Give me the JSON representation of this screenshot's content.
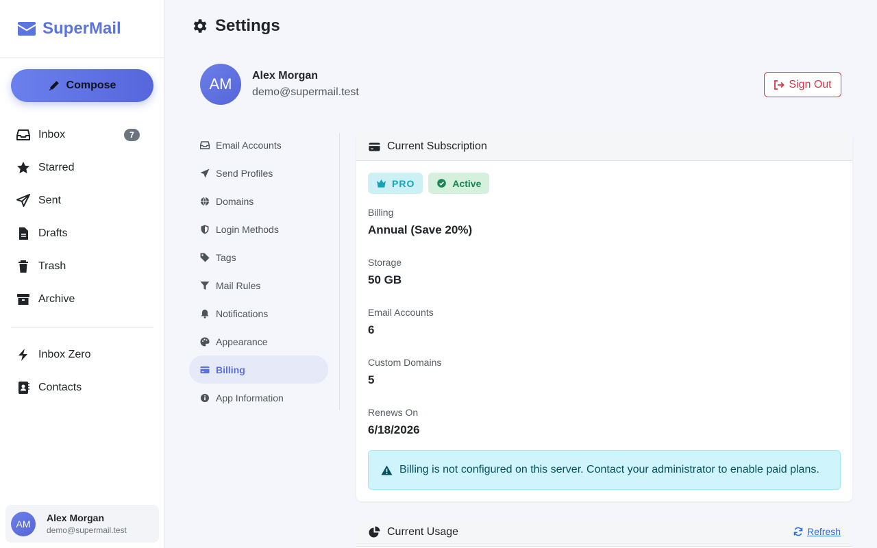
{
  "brand": {
    "name": "SuperMail",
    "icon": "envelope-icon"
  },
  "compose": {
    "label": "Compose",
    "icon": "pencil-icon"
  },
  "nav": {
    "items": [
      {
        "label": "Inbox",
        "icon": "inbox-icon",
        "badge": "7"
      },
      {
        "label": "Starred",
        "icon": "star-icon"
      },
      {
        "label": "Sent",
        "icon": "paper-plane-icon"
      },
      {
        "label": "Drafts",
        "icon": "file-icon"
      },
      {
        "label": "Trash",
        "icon": "trash-icon"
      },
      {
        "label": "Archive",
        "icon": "archive-icon"
      }
    ],
    "extra": [
      {
        "label": "Inbox Zero",
        "icon": "bolt-icon"
      },
      {
        "label": "Contacts",
        "icon": "address-book-icon"
      }
    ]
  },
  "user": {
    "initials": "AM",
    "name": "Alex Morgan",
    "email": "demo@supermail.test"
  },
  "page": {
    "title": "Settings",
    "icon": "gear-icon",
    "sign_out": "Sign Out"
  },
  "settings_nav": {
    "items": [
      {
        "label": "Email Accounts",
        "icon": "inbox-icon"
      },
      {
        "label": "Send Profiles",
        "icon": "paper-plane-icon"
      },
      {
        "label": "Domains",
        "icon": "globe-icon"
      },
      {
        "label": "Login Methods",
        "icon": "shield-icon"
      },
      {
        "label": "Tags",
        "icon": "tag-icon"
      },
      {
        "label": "Mail Rules",
        "icon": "filter-icon"
      },
      {
        "label": "Notifications",
        "icon": "bell-icon"
      },
      {
        "label": "Appearance",
        "icon": "palette-icon"
      },
      {
        "label": "Billing",
        "icon": "credit-card-icon",
        "active": true
      },
      {
        "label": "App Information",
        "icon": "info-icon"
      }
    ]
  },
  "subscription": {
    "title": "Current Subscription",
    "plan_badge": "PRO",
    "status_badge": "Active",
    "fields": [
      {
        "label": "Billing",
        "value": "Annual (Save 20%)"
      },
      {
        "label": "Storage",
        "value": "50 GB"
      },
      {
        "label": "Email Accounts",
        "value": "6"
      },
      {
        "label": "Custom Domains",
        "value": "5"
      },
      {
        "label": "Renews On",
        "value": "6/18/2026"
      }
    ],
    "alert": "Billing is not configured on this server. Contact your administrator to enable paid plans."
  },
  "usage": {
    "title": "Current Usage",
    "refresh": "Refresh"
  },
  "colors": {
    "accent": "#5b74e0",
    "danger": "#dc3545",
    "info": "#17a2b8",
    "success": "#198754"
  }
}
